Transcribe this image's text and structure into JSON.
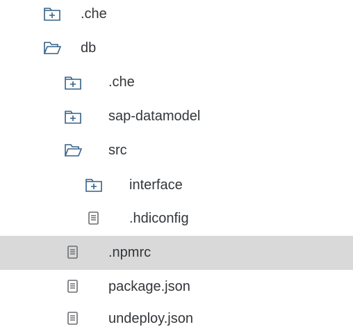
{
  "tree": {
    "items": [
      {
        "label": ".che",
        "icon": "folder-closed-icon"
      },
      {
        "label": "db",
        "icon": "folder-open-icon"
      },
      {
        "label": ".che",
        "icon": "folder-closed-icon"
      },
      {
        "label": "sap-datamodel",
        "icon": "folder-closed-icon"
      },
      {
        "label": "src",
        "icon": "folder-open-icon"
      },
      {
        "label": "interface",
        "icon": "folder-closed-icon"
      },
      {
        "label": ".hdiconfig",
        "icon": "file-icon"
      },
      {
        "label": ".npmrc",
        "icon": "file-icon",
        "selected": true
      },
      {
        "label": "package.json",
        "icon": "file-icon"
      },
      {
        "label": "undeploy.json",
        "icon": "file-icon"
      }
    ]
  },
  "colors": {
    "icon": "#346187",
    "file_icon": "#6a6d70",
    "text": "#32363a",
    "selected_background": "#d9d9d9"
  }
}
